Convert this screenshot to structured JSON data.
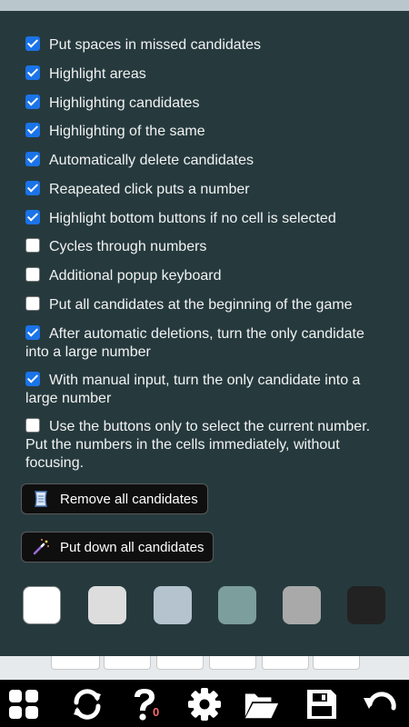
{
  "settings": {
    "options": [
      {
        "label": "Put spaces in missed candidates",
        "checked": true
      },
      {
        "label": "Highlight areas",
        "checked": true
      },
      {
        "label": "Highlighting candidates",
        "checked": true
      },
      {
        "label": "Highlighting of the same",
        "checked": true
      },
      {
        "label": "Automatically delete candidates",
        "checked": true
      },
      {
        "label": "Reapeated click puts a number",
        "checked": true
      },
      {
        "label": "Highlight bottom buttons if no cell is selected",
        "checked": true
      },
      {
        "label": "Cycles through numbers",
        "checked": false
      },
      {
        "label": "Additional popup keyboard",
        "checked": false
      },
      {
        "label": "Put all candidates at the beginning of the game",
        "checked": false
      },
      {
        "label": "After automatic deletions, turn the only candidate into a large number",
        "checked": true
      },
      {
        "label": "With manual input, turn the only candidate into a large number",
        "checked": true
      },
      {
        "label": "Use the buttons only to select the current number. Put the numbers in the cells immediately, without focusing.",
        "checked": false
      }
    ],
    "remove_all_label": "Remove all candidates",
    "put_down_all_label": "Put down all candidates",
    "theme_colors": [
      "#ffffff",
      "#dddddd",
      "#b5c3cf",
      "#7c9e9c",
      "#a9a9a9",
      "#222222"
    ]
  },
  "toolbar": {
    "icons": [
      "grid-icon",
      "refresh-icon",
      "help-icon",
      "gear-icon",
      "folder-icon",
      "save-icon",
      "undo-icon"
    ],
    "help_count": "0"
  }
}
